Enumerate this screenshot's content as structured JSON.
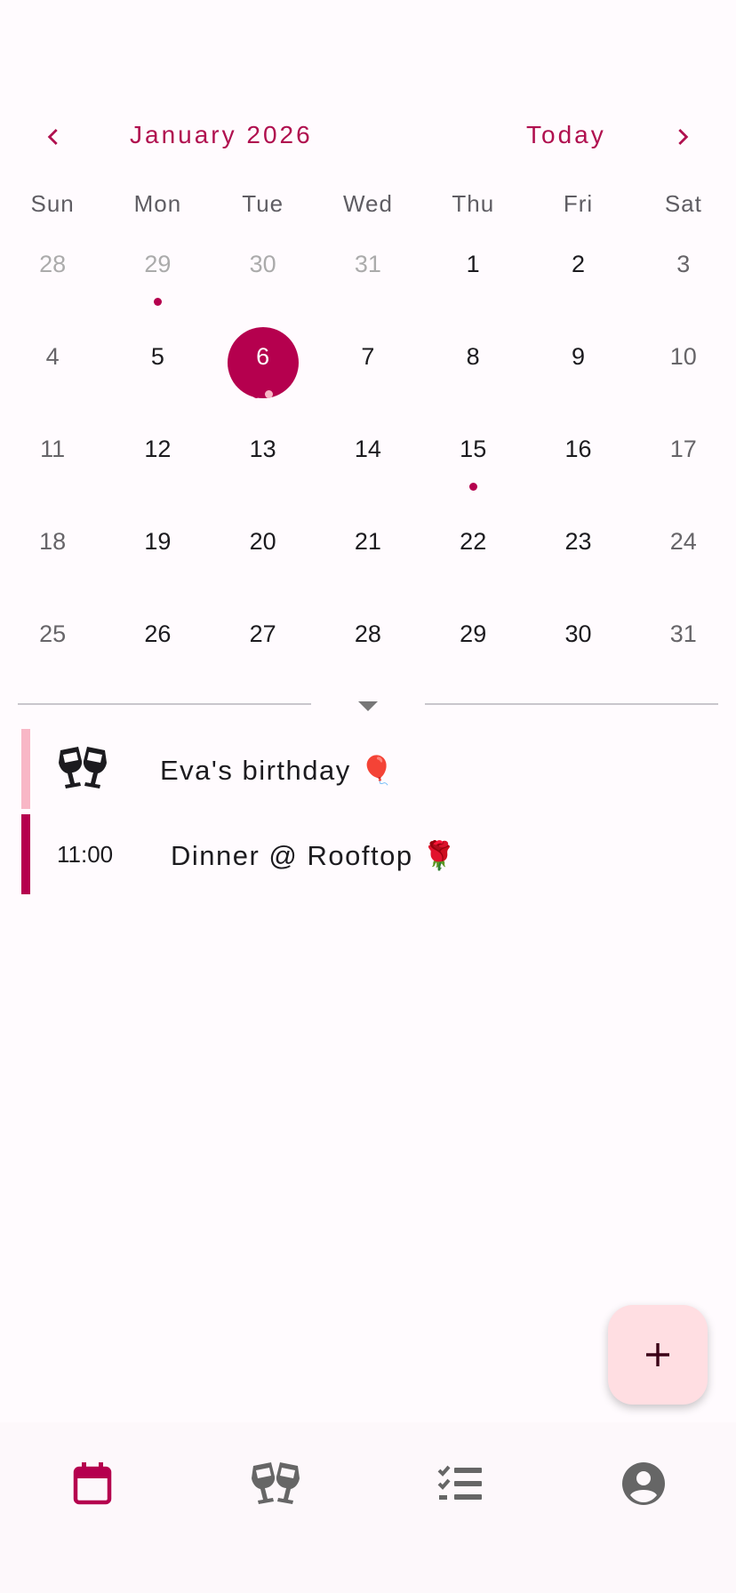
{
  "colors": {
    "accent": "#b0104f",
    "selected_day": "#b5004e",
    "event_dark": "#b5004e",
    "event_light": "#f8b7c6",
    "fab_bg": "#ffdee2",
    "nav_inactive": "#666666"
  },
  "header": {
    "prev_icon": "chevron-left-icon",
    "month_label": "January 2026",
    "today_label": "Today",
    "next_icon": "chevron-right-icon"
  },
  "weekdays": [
    "Sun",
    "Mon",
    "Tue",
    "Wed",
    "Thu",
    "Fri",
    "Sat"
  ],
  "calendar": {
    "selected_day": 6,
    "days": [
      {
        "n": "28",
        "outside": true
      },
      {
        "n": "29",
        "outside": true,
        "dots": [
          "dark"
        ]
      },
      {
        "n": "30",
        "outside": true
      },
      {
        "n": "31",
        "outside": true
      },
      {
        "n": "1"
      },
      {
        "n": "2"
      },
      {
        "n": "3",
        "weekend": true
      },
      {
        "n": "4",
        "weekend": true
      },
      {
        "n": "5"
      },
      {
        "n": "6",
        "selected": true,
        "dots": [
          "dark",
          "light"
        ]
      },
      {
        "n": "7"
      },
      {
        "n": "8"
      },
      {
        "n": "9"
      },
      {
        "n": "10",
        "weekend": true
      },
      {
        "n": "11",
        "weekend": true
      },
      {
        "n": "12"
      },
      {
        "n": "13"
      },
      {
        "n": "14"
      },
      {
        "n": "15",
        "dots": [
          "dark"
        ]
      },
      {
        "n": "16"
      },
      {
        "n": "17",
        "weekend": true
      },
      {
        "n": "18",
        "weekend": true
      },
      {
        "n": "19"
      },
      {
        "n": "20"
      },
      {
        "n": "21"
      },
      {
        "n": "22"
      },
      {
        "n": "23"
      },
      {
        "n": "24",
        "weekend": true
      },
      {
        "n": "25",
        "weekend": true
      },
      {
        "n": "26"
      },
      {
        "n": "27"
      },
      {
        "n": "28"
      },
      {
        "n": "29"
      },
      {
        "n": "30"
      },
      {
        "n": "31",
        "weekend": true
      }
    ]
  },
  "events": [
    {
      "title": "Eva's birthday 🎈",
      "icon": "cheers-glasses-icon",
      "time": "",
      "color": "light"
    },
    {
      "title": "Dinner @ Rooftop 🌹",
      "icon": "",
      "time": "11:00",
      "color": "dark"
    }
  ],
  "fab": {
    "icon": "plus-icon"
  },
  "bottom_nav": [
    {
      "icon": "calendar-icon",
      "active": true
    },
    {
      "icon": "cheers-glasses-icon",
      "active": false
    },
    {
      "icon": "checklist-icon",
      "active": false
    },
    {
      "icon": "account-circle-icon",
      "active": false
    }
  ]
}
